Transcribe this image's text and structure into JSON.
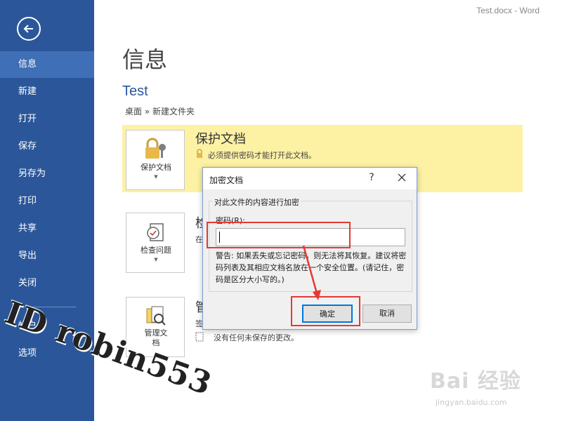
{
  "window": {
    "title": "Test.docx - Word"
  },
  "sidebar": {
    "items": [
      {
        "label": "信息",
        "active": true
      },
      {
        "label": "新建"
      },
      {
        "label": "打开"
      },
      {
        "label": "保存"
      },
      {
        "label": "另存为"
      },
      {
        "label": "打印"
      },
      {
        "label": "共享"
      },
      {
        "label": "导出"
      },
      {
        "label": "关闭"
      },
      {
        "label": "帐户"
      },
      {
        "label": "选项"
      }
    ]
  },
  "main": {
    "page_title": "信息",
    "doc_name": "Test",
    "breadcrumb": "桌面 » 新建文件夹",
    "protect": {
      "tile_label": "保护文档",
      "title": "保护文档",
      "description": "必须提供密码才能打开此文档。"
    },
    "inspect": {
      "tile_label": "检查问题",
      "title": "检",
      "desc": "在"
    },
    "manage": {
      "tile_label_line1": "管理文",
      "tile_label_line2": "档",
      "title": "管",
      "desc1": "签",
      "desc2": "没有任何未保存的更改。"
    }
  },
  "dialog": {
    "title": "加密文档",
    "help": "?",
    "group_title": "对此文件的内容进行加密",
    "password_label": "密码(R):",
    "password_value": "",
    "warning": "警告: 如果丢失或忘记密码，则无法将其恢复。建议将密码列表及其相应文档名放在一个安全位置。(请记住，密码是区分大小写的。)",
    "ok_label": "确定",
    "cancel_label": "取消"
  },
  "watermark": {
    "text": "ID robin553"
  },
  "baidu": {
    "logo": "Bai 经验",
    "url": "jingyan.baidu.com"
  },
  "colors": {
    "sidebar": "#2b579a",
    "sidebar_active": "#3f6fb6",
    "highlight": "#fdf1a4",
    "annotation": "#e53935"
  }
}
